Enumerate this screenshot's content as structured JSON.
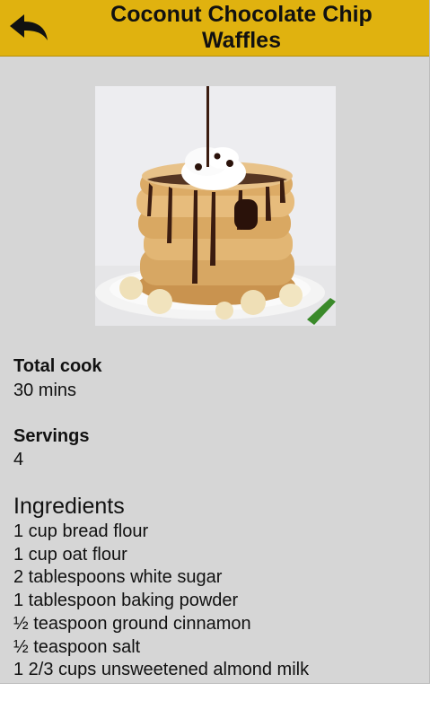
{
  "header": {
    "title_line1": "Coconut Chocolate Chip",
    "title_line2": "Waffles",
    "back_icon": "back-arrow-icon"
  },
  "recipe": {
    "image_alt": "Stack of waffles with whipped cream and chocolate syrup",
    "total_cook_label": "Total cook",
    "total_cook_value": "30 mins",
    "servings_label": "Servings",
    "servings_value": "4",
    "ingredients_heading": "Ingredients",
    "ingredients": [
      "1 cup bread flour",
      "1 cup oat flour",
      "2 tablespoons white sugar",
      "1 tablespoon baking powder",
      "½ teaspoon ground cinnamon",
      "½ teaspoon salt",
      "1 2/3 cups unsweetened almond milk"
    ]
  },
  "colors": {
    "header_bg": "#e0b20f",
    "page_bg": "#d6d6d6"
  }
}
